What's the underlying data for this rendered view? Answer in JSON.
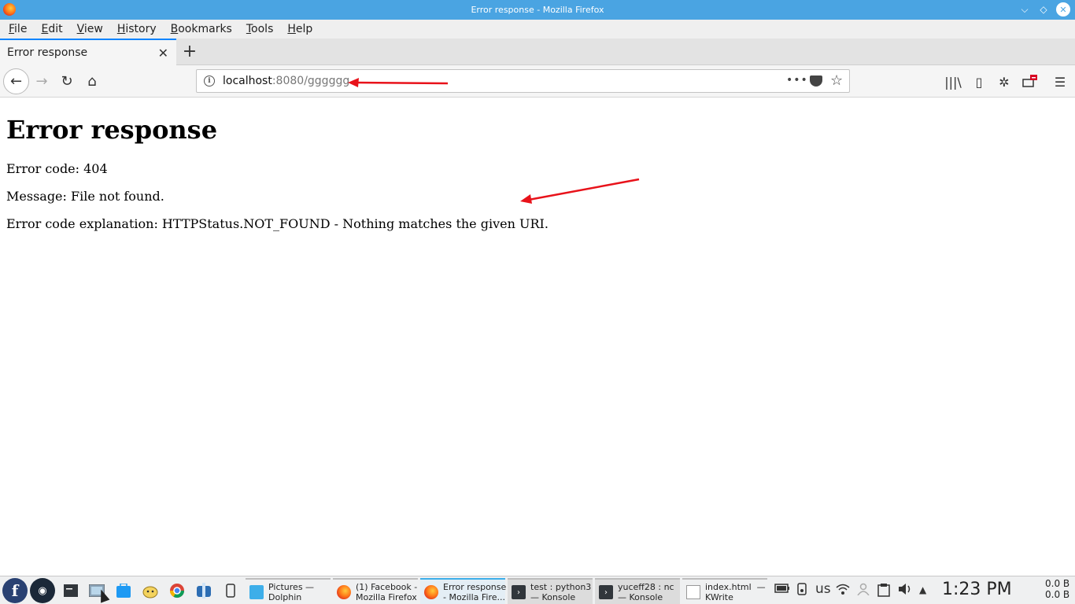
{
  "window": {
    "title": "Error response - Mozilla Firefox",
    "controls": {
      "minimize": "⌵",
      "maximize": "◇",
      "close": "✕"
    }
  },
  "menubar": {
    "items": [
      {
        "label": "File",
        "u": "F",
        "rest": "ile"
      },
      {
        "label": "Edit",
        "u": "E",
        "rest": "dit"
      },
      {
        "label": "View",
        "u": "V",
        "rest": "iew"
      },
      {
        "label": "History",
        "u": "H",
        "rest": "istory"
      },
      {
        "label": "Bookmarks",
        "u": "B",
        "rest": "ookmarks"
      },
      {
        "label": "Tools",
        "u": "T",
        "rest": "ools"
      },
      {
        "label": "Help",
        "u": "H",
        "rest": "elp"
      }
    ]
  },
  "tabs": [
    {
      "label": "Error response",
      "close": "✕"
    }
  ],
  "new_tab": "+",
  "navbar": {
    "back": "←",
    "forward": "→",
    "reload": "↻",
    "home": "⌂",
    "url_host": "localhost",
    "url_rest": ":8080/gggggg",
    "page_actions": "•••",
    "bookmark_star": "☆",
    "library": "|||\\",
    "sidebar": "▯",
    "menu": "☰"
  },
  "page": {
    "heading": "Error response",
    "error_code": "Error code: 404",
    "message": "Message: File not found.",
    "explanation": "Error code explanation: HTTPStatus.NOT_FOUND - Nothing matches the given URI."
  },
  "annotations": {
    "arrow_color": "#e8121a"
  },
  "taskbar": {
    "fedora": "f",
    "steam": "◉",
    "tasks": [
      {
        "line1": "Pictures —",
        "line2": "Dolphin",
        "icon": "folder"
      },
      {
        "line1": "(1) Facebook -",
        "line2": "Mozilla Firefox",
        "icon": "ff"
      },
      {
        "line1": "Error response",
        "line2": "- Mozilla Fire...",
        "icon": "ff"
      },
      {
        "line1": "test : python3",
        "line2": "— Konsole",
        "icon": "term"
      },
      {
        "line1": "yuceff28 : nc",
        "line2": "— Konsole",
        "icon": "term"
      },
      {
        "line1": "index.html  —",
        "line2": "KWrite",
        "icon": "doc"
      }
    ],
    "keyboard_layout": "us",
    "clock": "1:23 PM",
    "net_up": "0.0 B",
    "net_down": "0.0 B"
  },
  "colors": {
    "titlebar": "#4aa4e2",
    "tab_accent": "#0a84ff",
    "taskbar_accent": "#3daee9"
  }
}
